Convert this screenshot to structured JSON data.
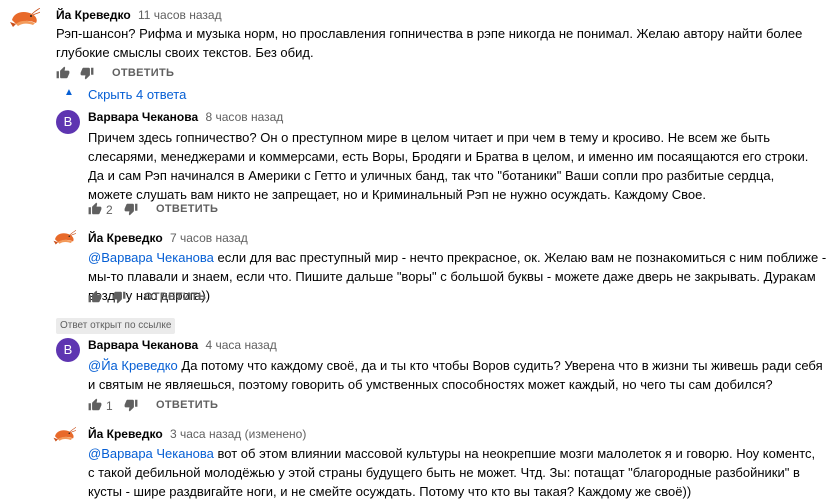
{
  "comments": [
    {
      "author": "Йа Креведко",
      "time": "11 часов назад",
      "text": "Рэп-шансон? Рифма и музыка норм, но прославления гопничества в рэпе никогда не понимал. Желаю автору найти более глубокие смыслы своих текстов. Без обид.",
      "reply_label": "ОТВЕТИТЬ"
    },
    {
      "author": "Варвара Чеканова",
      "avatar_letter": "В",
      "time": "8 часов назад",
      "text": "Причем здесь гопничество? Он о преступном мире в целом читает и при чем в тему и кросиво. Не всем же быть слесарями, менеджерами и коммерсами, есть Воры, Бродяги и Братва в целом, и именно им посаящаются его строки. Да и сам Рэп начинался в Америки с Гетто и уличных банд, так что \"ботаники\" Ваши сопли про разбитые сердца, можете слушать вам никто не запрещает, но и Криминальный Рэп не нужно осуждать. Каждому Свое.",
      "likes": "2",
      "reply_label": "ОТВЕТИТЬ"
    },
    {
      "author": "Йа Креведко",
      "time": "7 часов назад",
      "mention": "@Варвара Чеканова",
      "text": "если для вас преступный мир - нечто прекрасное, ок. Желаю вам не познакомиться с ним поближе - мы-то плавали и знаем, если что. Пишите дальше \"воры\" с большой буквы - можете даже дверь не закрывать. Дуракам везде у нас дорога))",
      "reply_label": "ОТВЕТИТЬ"
    },
    {
      "author": "Варвара Чеканова",
      "avatar_letter": "В",
      "time": "4 часа назад",
      "mention": "@Йа Креведко",
      "text": "Да потому что каждому своё, да и ты кто чтобы Воров судить? Уверена что в жизни ты живешь ради себя и святым не являешься, поэтому говорить об умственных способностях может каждый, но чего ты сам добился?",
      "likes": "1",
      "reply_label": "ОТВЕТИТЬ"
    },
    {
      "author": "Йа Креведко",
      "time": "3 часа назад (изменено)",
      "mention": "@Варвара Чеканова",
      "text": "вот об этом влиянии массовой культуры на неокрепшие мозги малолеток я и говорю. Ноу коментс, с такой дебильной молодёжью у этой страны будущего быть не может. Чтд. Зы: потащат \"благородные разбойники\" в кусты - шире раздвигайте ноги, и не смейте осуждать. Потому что кто вы такая? Каждому же своё))"
    }
  ],
  "hide_replies_label": "Скрыть 4 ответа",
  "linked_badge": "Ответ открыт по ссылке",
  "colors": {
    "link": "#065fd4",
    "avatar_bg": "#5e35b1",
    "meta": "#606060"
  }
}
